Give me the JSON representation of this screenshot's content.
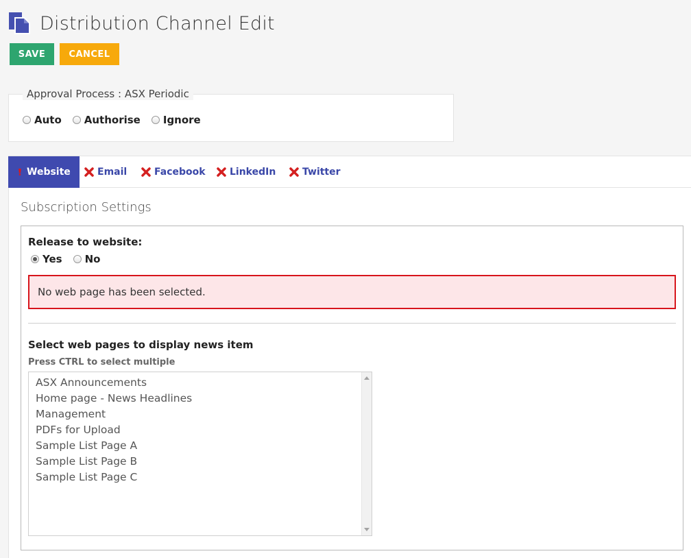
{
  "header": {
    "title": "Distribution Channel Edit",
    "icon": "document-copy-icon",
    "accent": "#4550b0"
  },
  "toolbar": {
    "save_label": "SAVE",
    "cancel_label": "CANCEL",
    "save_color": "#2ea56f",
    "cancel_color": "#f7a90b"
  },
  "approval": {
    "legend": "Approval Process : ASX Periodic",
    "options": [
      {
        "label": "Auto",
        "checked": false
      },
      {
        "label": "Authorise",
        "checked": false
      },
      {
        "label": "Ignore",
        "checked": false
      }
    ]
  },
  "tabs": [
    {
      "label": "Website",
      "icon": "exclamation-icon",
      "active": true
    },
    {
      "label": "Email",
      "icon": "red-x-icon",
      "active": false
    },
    {
      "label": "Facebook",
      "icon": "red-x-icon",
      "active": false
    },
    {
      "label": "LinkedIn",
      "icon": "red-x-icon",
      "active": false
    },
    {
      "label": "Twitter",
      "icon": "red-x-icon",
      "active": false
    }
  ],
  "subscription": {
    "title": "Subscription Settings",
    "release_label": "Release to website:",
    "release_options": [
      {
        "label": "Yes",
        "checked": true
      },
      {
        "label": "No",
        "checked": false
      }
    ],
    "alert_text": "No web page has been selected.",
    "alert_color": "#d7141b",
    "select_label": "Select web pages to display news item",
    "select_hint": "Press CTRL to select multiple",
    "pages": [
      "ASX Announcements",
      "Home page - News Headlines",
      "Management",
      "PDFs for Upload",
      "Sample List Page A",
      "Sample List Page B",
      "Sample List Page C"
    ]
  }
}
